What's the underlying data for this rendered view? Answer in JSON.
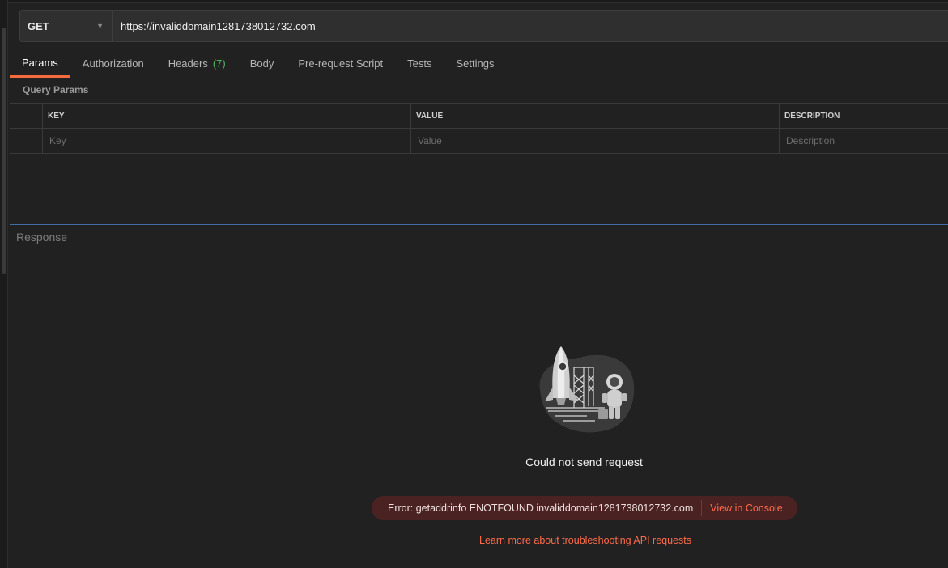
{
  "request": {
    "method": "GET",
    "url": "https://invaliddomain1281738012732.com"
  },
  "tabs": [
    {
      "label": "Params",
      "active": true
    },
    {
      "label": "Authorization"
    },
    {
      "label": "Headers",
      "count": "(7)"
    },
    {
      "label": "Body"
    },
    {
      "label": "Pre-request Script"
    },
    {
      "label": "Tests"
    },
    {
      "label": "Settings"
    }
  ],
  "params": {
    "title": "Query Params",
    "columns": {
      "key": "KEY",
      "value": "VALUE",
      "description": "DESCRIPTION"
    },
    "placeholders": {
      "key": "Key",
      "value": "Value",
      "description": "Description"
    }
  },
  "response": {
    "label": "Response",
    "error_title": "Could not send request",
    "error_message": "Error: getaddrinfo ENOTFOUND invaliddomain1281738012732.com",
    "console_link": "View in Console",
    "learn_more": "Learn more about troubleshooting API requests"
  },
  "colors": {
    "accent": "#f26b3a",
    "link": "#ff6b4a",
    "count": "#4fb35c",
    "error_bg": "#4a2222"
  }
}
